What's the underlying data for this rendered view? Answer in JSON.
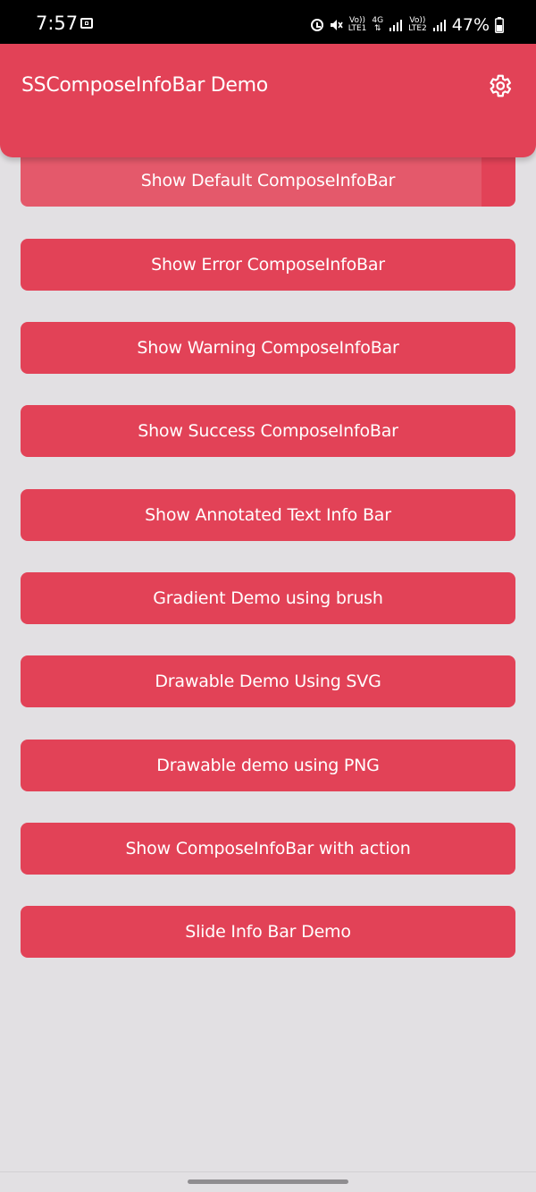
{
  "status_bar": {
    "time": "7:57",
    "network_1": {
      "top": "Vo))",
      "bottom": "LTE1"
    },
    "network_2": {
      "top": "Vo))",
      "bottom": "LTE2"
    },
    "network_type": "4G",
    "battery": "47%",
    "icons": [
      "screencast-icon",
      "alarm-icon",
      "mute-icon",
      "signal-icon",
      "battery-icon"
    ]
  },
  "app_bar": {
    "title": "SSComposeInfoBar Demo",
    "settings_icon": "gear-icon",
    "background_color": "#e24257"
  },
  "buttons": [
    "Show Default ComposeInfoBar",
    "Show Error ComposeInfoBar",
    "Show Warning ComposeInfoBar",
    "Show Success ComposeInfoBar",
    "Show Annotated Text Info Bar",
    "Gradient Demo using brush",
    "Drawable Demo Using SVG",
    "Drawable demo using PNG",
    "Show ComposeInfoBar with action",
    "Slide Info Bar Demo"
  ],
  "colors": {
    "accent": "#e24257",
    "background": "#e2e0e3",
    "button_text": "#ffffff"
  }
}
